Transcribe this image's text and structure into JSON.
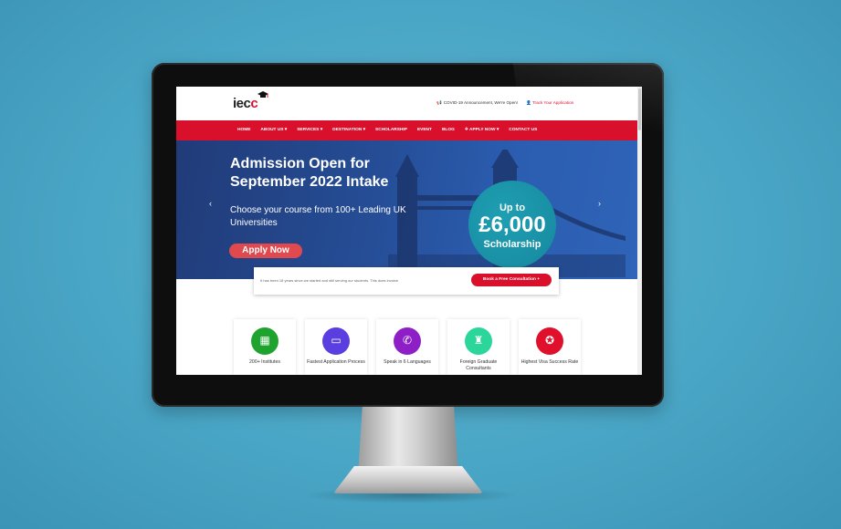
{
  "site": {
    "logo_text_a": "iec",
    "logo_text_b": "c",
    "covid_notice": "COVID-19 Announcement, We're Open!",
    "track_link": "Track Your Application"
  },
  "nav": {
    "items": [
      "HOME",
      "ABOUT US ▾",
      "SERVICES ▾",
      "DESTINATION ▾",
      "SCHOLARSHIP",
      "EVENT",
      "BLOG",
      "✈ APPLY NOW ▾",
      "CONTACT US"
    ]
  },
  "hero": {
    "title": "Admission Open for September 2022 Intake",
    "subtitle": "Choose your course from 100+ Leading UK Universities",
    "cta": "Apply Now",
    "badge_top": "Up to",
    "badge_amount": "£6,000",
    "badge_bottom": "Scholarship",
    "prev": "‹",
    "next": "›"
  },
  "info": {
    "text": "It has been 18 years since we started and still serving our students. This does involve",
    "button": "Book a Free Consultation +"
  },
  "features": [
    {
      "label": "200+ Institutes",
      "icon": "building-icon",
      "color": "#1fa32f",
      "glyph": "▦"
    },
    {
      "label": "Fastest Application Process",
      "icon": "laptop-icon",
      "color": "#5b3ee0",
      "glyph": "▭"
    },
    {
      "label": "Speak in 6 Languages",
      "icon": "phone-icon",
      "color": "#8e1fc7",
      "glyph": "✆"
    },
    {
      "label": "Foreign Graduate Consultants",
      "icon": "graduates-icon",
      "color": "#2bd69a",
      "glyph": "♜"
    },
    {
      "label": "Highest Visa Success Rate",
      "icon": "visa-badge-icon",
      "color": "#e0102c",
      "glyph": "✪"
    }
  ],
  "colors": {
    "brand_red": "#d8102c",
    "hero_blue": "#254c94",
    "badge_teal": "#16889e"
  }
}
